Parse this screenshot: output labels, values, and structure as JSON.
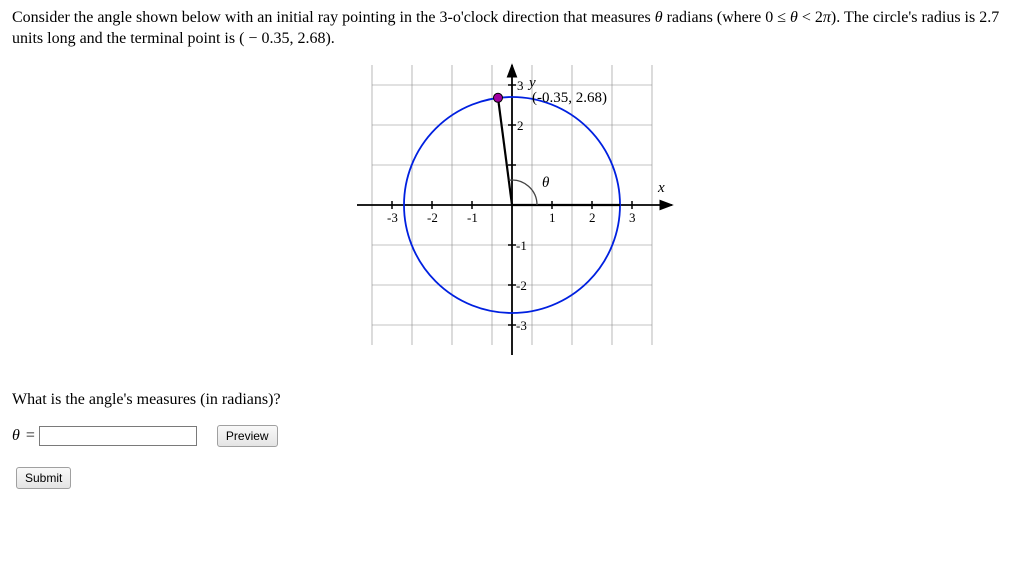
{
  "problem": {
    "text_part1": "Consider the angle shown below with an initial ray pointing in the 3-o'clock direction that measures ",
    "theta": "θ",
    "text_part2": " radians (where 0 ≤ ",
    "text_part3": " < 2",
    "pi": "π",
    "text_part4": "). The circle's radius is 2.7 units long and the terminal point is ( − 0.35, 2.68)."
  },
  "chart_data": {
    "type": "diagram",
    "description": "Unit circle angle diagram",
    "radius": 2.7,
    "terminal_point": {
      "x": -0.35,
      "y": 2.68
    },
    "terminal_label": "(-0.35, 2.68)",
    "axis_range": {
      "min": -3.5,
      "max": 3.5
    },
    "x_ticks": [
      -3,
      -2,
      -1,
      1,
      2,
      3
    ],
    "y_ticks": [
      -3,
      -2,
      -1,
      2,
      3
    ],
    "angle_label": "θ",
    "x_axis_label": "x",
    "y_axis_label": "y"
  },
  "question": "What is the angle's measures (in radians)?",
  "answer": {
    "label_theta": "θ",
    "label_equals": " = ",
    "placeholder": "",
    "value": ""
  },
  "buttons": {
    "preview": "Preview",
    "submit": "Submit"
  }
}
